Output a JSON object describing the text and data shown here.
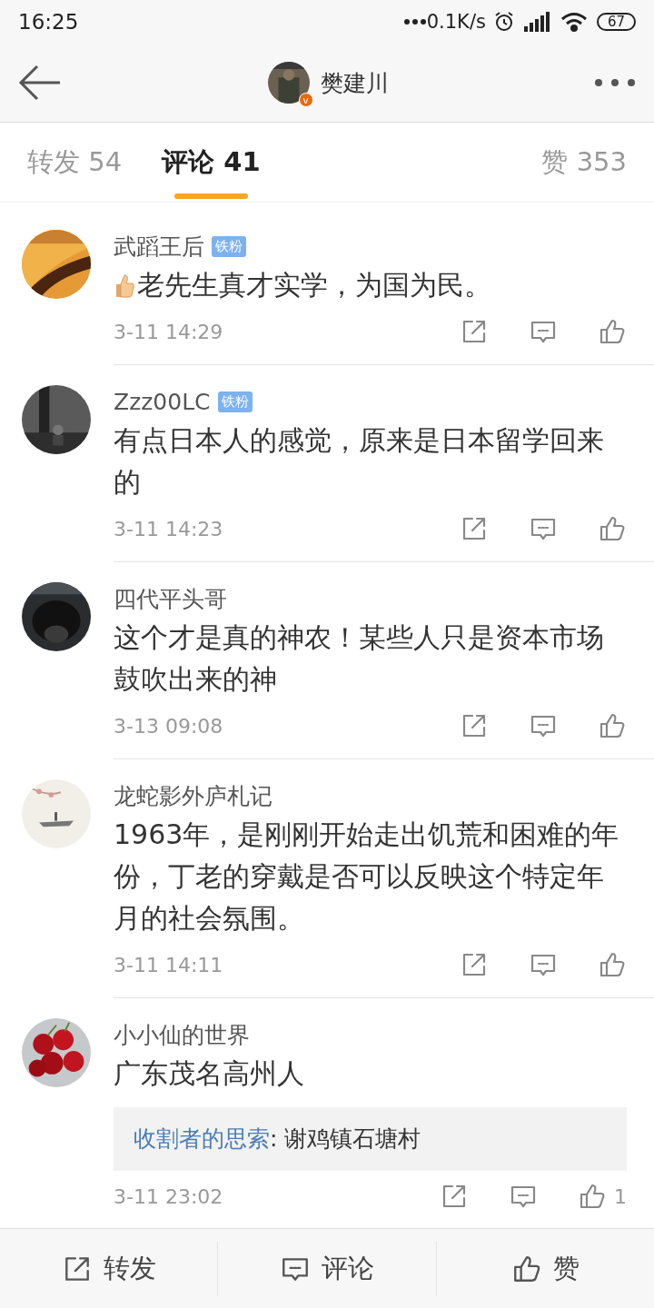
{
  "status_bar": {
    "time": "16:25",
    "network_speed": "0.1K/s",
    "battery": "67"
  },
  "header": {
    "title": "樊建川",
    "verified_mark": "v"
  },
  "tabs": [
    {
      "label": "转发 54",
      "selected": false
    },
    {
      "label": "评论 41",
      "selected": true
    },
    {
      "label": "赞 353",
      "selected": false
    }
  ],
  "comments": [
    {
      "author": "武蹈王后",
      "badge": "铁粉",
      "thumb_emoji": true,
      "text": "老先生真才实学，为国为民。",
      "time": "3-11 14:29"
    },
    {
      "author": "Zzz00LC",
      "badge": "铁粉",
      "text": "有点日本人的感觉，原来是日本留学回来的",
      "time": "3-11 14:23"
    },
    {
      "author": "四代平头哥",
      "text": "这个才是真的神农！某些人只是资本市场鼓吹出来的神",
      "time": "3-13 09:08"
    },
    {
      "author": "龙蛇影外庐札记",
      "text": "1963年，是刚刚开始走出饥荒和困难的年份，丁老的穿戴是否可以反映这个特定年月的社会氛围。",
      "time": "3-11 14:11"
    },
    {
      "author": "小小仙的世界",
      "text": "广东茂名高州人",
      "reply": {
        "author": "收割者的思索",
        "text": ": 谢鸡镇石塘村"
      },
      "time": "3-11 23:02",
      "likes": "1"
    }
  ],
  "bottom_bar": [
    {
      "kind": "repost",
      "label": "转发"
    },
    {
      "kind": "comment",
      "label": "评论"
    },
    {
      "kind": "like",
      "label": "赞"
    }
  ]
}
